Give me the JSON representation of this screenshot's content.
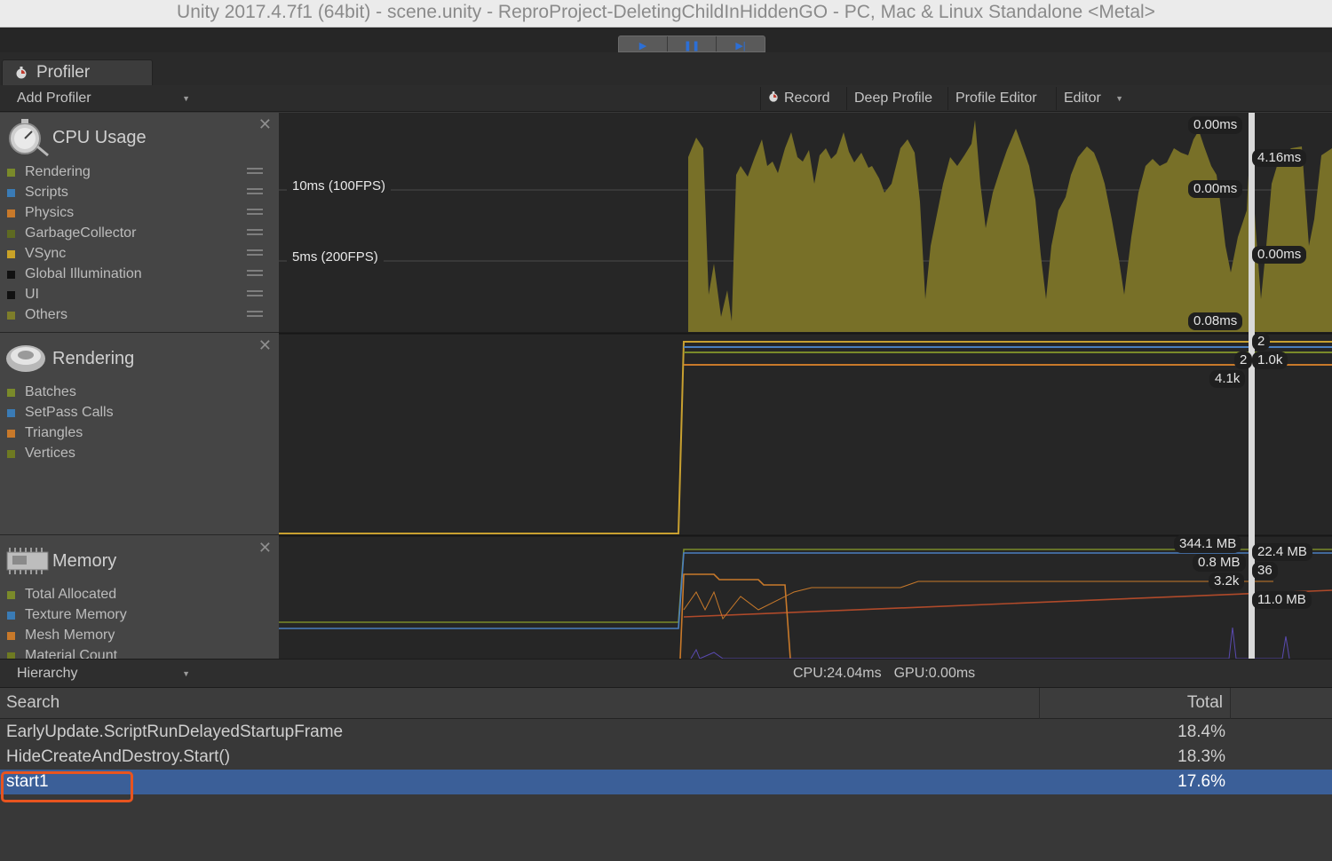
{
  "window": {
    "title": "Unity 2017.4.7f1 (64bit) - scene.unity - ReproProject-DeletingChildInHiddenGO - PC, Mac & Linux Standalone <Metal>"
  },
  "playbar": {
    "buttons": [
      {
        "glyph": "▶",
        "icon": "play-icon"
      },
      {
        "glyph": "❚❚",
        "icon": "pause-icon"
      },
      {
        "glyph": "▶|",
        "icon": "step-icon"
      }
    ]
  },
  "tab": {
    "label": "Profiler",
    "icon": "profiler-icon"
  },
  "toolbar": {
    "add_profiler": "Add Profiler",
    "record": "Record",
    "deep_profile": "Deep Profile",
    "profile_editor": "Profile Editor",
    "editor": "Editor"
  },
  "modules": {
    "cpu": {
      "title": "CPU Usage",
      "icon": "cpu-stopwatch-icon",
      "categories": [
        {
          "label": "Rendering",
          "color": "#7a8a2a"
        },
        {
          "label": "Scripts",
          "color": "#3a7bb5"
        },
        {
          "label": "Physics",
          "color": "#c8792a"
        },
        {
          "label": "GarbageCollector",
          "color": "#5e6a22"
        },
        {
          "label": "VSync",
          "color": "#c9a227"
        },
        {
          "label": "Global Illumination",
          "color": "#111111"
        },
        {
          "label": "UI",
          "color": "#111111"
        },
        {
          "label": "Others",
          "color": "#7d7d2a"
        }
      ],
      "fps_10ms": "10ms (100FPS)",
      "fps_5ms": "5ms (200FPS)",
      "readouts_left": [
        "0.00ms",
        "0.00ms",
        "0.08ms"
      ],
      "readouts_right": [
        "4.16ms",
        "0.00ms"
      ]
    },
    "rendering": {
      "title": "Rendering",
      "icon": "rendering-teapot-icon",
      "categories": [
        {
          "label": "Batches",
          "color": "#7a8a2a"
        },
        {
          "label": "SetPass Calls",
          "color": "#3a7bb5"
        },
        {
          "label": "Triangles",
          "color": "#c8792a"
        },
        {
          "label": "Vertices",
          "color": "#6e7a22"
        }
      ],
      "readouts_left": [
        "2",
        "4.1k"
      ],
      "readouts_right": [
        "2",
        "1.0k"
      ]
    },
    "memory": {
      "title": "Memory",
      "icon": "memory-chip-icon",
      "categories": [
        {
          "label": "Total Allocated",
          "color": "#7a8a2a"
        },
        {
          "label": "Texture Memory",
          "color": "#3a7bb5"
        },
        {
          "label": "Mesh Memory",
          "color": "#c8792a"
        },
        {
          "label": "Material Count",
          "color": "#6e7a22"
        }
      ],
      "readouts_left": [
        "344.1 MB",
        "0.8 MB",
        "3.2k"
      ],
      "readouts_right": [
        "22.4 MB",
        "36",
        "11.0 MB"
      ]
    }
  },
  "detail_bar": {
    "view": "Hierarchy",
    "cpu": "CPU:24.04ms",
    "gpu": "GPU:0.00ms"
  },
  "table": {
    "search_header": "Search",
    "total_header": "Total",
    "rows": [
      {
        "name": "EarlyUpdate.ScriptRunDelayedStartupFrame",
        "total": "18.4%"
      },
      {
        "name": "HideCreateAndDestroy.Start()",
        "total": "18.3%"
      },
      {
        "name": "start1",
        "total": "17.6%"
      }
    ]
  },
  "colors": {
    "cpu_fill": "#787028",
    "selection": "#3b5f98",
    "highlight": "#e8541f"
  }
}
